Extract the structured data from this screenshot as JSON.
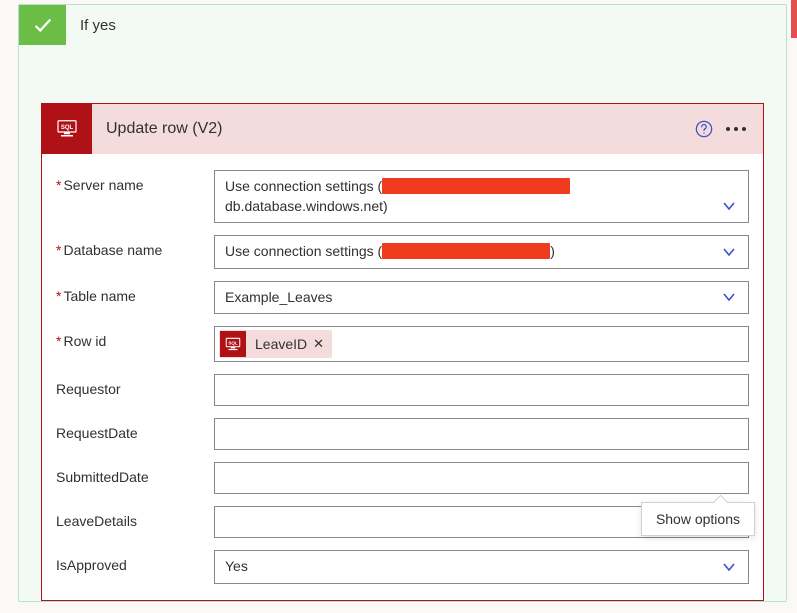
{
  "condition": {
    "branch_title": "If yes"
  },
  "action": {
    "title": "Update row (V2)",
    "fields": {
      "server_name": {
        "label": "Server name",
        "value_prefix": "Use connection settings (",
        "value_suffix_line2": "db.database.windows.net)"
      },
      "database_name": {
        "label": "Database name",
        "value_prefix": "Use connection settings (",
        "value_suffix": ")"
      },
      "table_name": {
        "label": "Table name",
        "value": "Example_Leaves"
      },
      "row_id": {
        "label": "Row id",
        "token": "LeaveID"
      },
      "requestor": {
        "label": "Requestor"
      },
      "request_date": {
        "label": "RequestDate"
      },
      "submitted_date": {
        "label": "SubmittedDate"
      },
      "leave_details": {
        "label": "LeaveDetails"
      },
      "is_approved": {
        "label": "IsApproved",
        "value": "Yes"
      }
    },
    "tooltip": "Show options"
  }
}
